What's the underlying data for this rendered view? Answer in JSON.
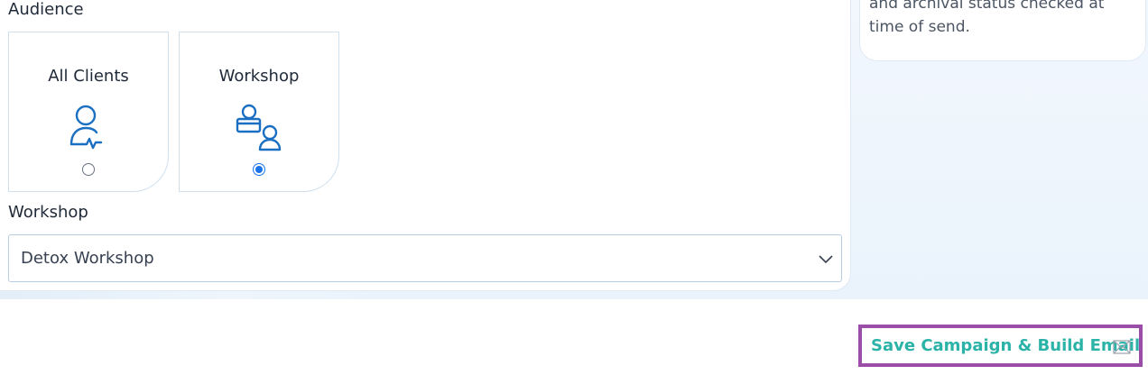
{
  "audience": {
    "label": "Audience",
    "options": [
      {
        "title": "All Clients",
        "icon": "client-activity-icon",
        "selected": false
      },
      {
        "title": "Workshop",
        "icon": "workshop-users-icon",
        "selected": true
      }
    ]
  },
  "workshop": {
    "label": "Workshop",
    "selected_value": "Detox Workshop",
    "chevron_icon": "chevron-down-icon"
  },
  "info_panel": {
    "text": "and archival status checked at time of send."
  },
  "actions": {
    "save_label": "Save Campaign & Build Email",
    "save_icon": "envelope-icon"
  },
  "colors": {
    "accent_blue": "#1a73e8",
    "icon_blue": "#1b6fc2",
    "button_text": "#2bb3a8",
    "button_border": "#9b4ea8"
  }
}
